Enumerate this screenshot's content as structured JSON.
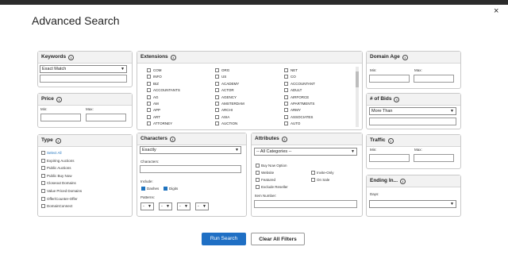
{
  "modal": {
    "title": "Advanced Search",
    "close_label": "×"
  },
  "keywords": {
    "header": "Keywords",
    "mode": "Exact Match",
    "value": ""
  },
  "price": {
    "header": "Price",
    "min_label": "Min:",
    "max_label": "Max:"
  },
  "type": {
    "header": "Type",
    "items": [
      {
        "label": "Select All",
        "checked": false,
        "link": true
      },
      {
        "label": "Expiring Auctions",
        "checked": false
      },
      {
        "label": "Public Auctions",
        "checked": false
      },
      {
        "label": "Public Buy Now",
        "checked": false
      },
      {
        "label": "Closeout Domains",
        "checked": false
      },
      {
        "label": "Value Priced Domains",
        "checked": false
      },
      {
        "label": "Offer/Counter-Offer",
        "checked": false
      },
      {
        "label": "DomainConnect",
        "checked": false
      }
    ]
  },
  "extensions": {
    "header": "Extensions",
    "col1": [
      "COM",
      "INFO",
      "BIZ",
      "ACCOUNTANTS",
      "AG",
      "AM",
      "APP",
      "ART",
      "ATTORNEY"
    ],
    "col2": [
      "ORG",
      "US",
      "ACADEMY",
      "ACTOR",
      "AGENCY",
      "AMSTERDAM",
      "ARCHI",
      "ASIA",
      "AUCTION"
    ],
    "col3": [
      "NET",
      "CO",
      "ACCOUNTANT",
      "ADULT",
      "AIRFORCE",
      "APARTMENTS",
      "ARMY",
      "ASSOCIATES",
      "AUTO"
    ]
  },
  "characters": {
    "header": "Characters",
    "mode": "Exactly",
    "chars_label": "Characters:",
    "include_label": "Include:",
    "dashes_label": "Dashes",
    "digits_label": "Digits",
    "patterns_label": "Patterns:",
    "pattern_values": [
      "-",
      "-",
      "-",
      "-"
    ]
  },
  "attributes": {
    "header": "Attributes",
    "category": "-- All Categories --",
    "items": [
      {
        "label": "Buy Now Option"
      },
      {
        "label": "Website"
      },
      {
        "label": "Invite-Only"
      },
      {
        "label": "Featured"
      },
      {
        "label": "On Sale"
      },
      {
        "label": "Exclude Reseller"
      }
    ],
    "item_number_label": "Item Number:"
  },
  "domain_age": {
    "header": "Domain Age",
    "min_label": "Min:",
    "max_label": "Max:"
  },
  "bids": {
    "header": "# of Bids",
    "mode": "More Than"
  },
  "traffic": {
    "header": "Traffic",
    "min_label": "Min:",
    "max_label": "Max:"
  },
  "ending": {
    "header": "Ending In...",
    "days_label": "Days:"
  },
  "actions": {
    "run_label": "Run Search",
    "clear_label": "Clear All Filters"
  },
  "colors": {
    "primary": "#1f6fc4",
    "overlay": "#7d7d7d",
    "accent": "#1e73be"
  }
}
